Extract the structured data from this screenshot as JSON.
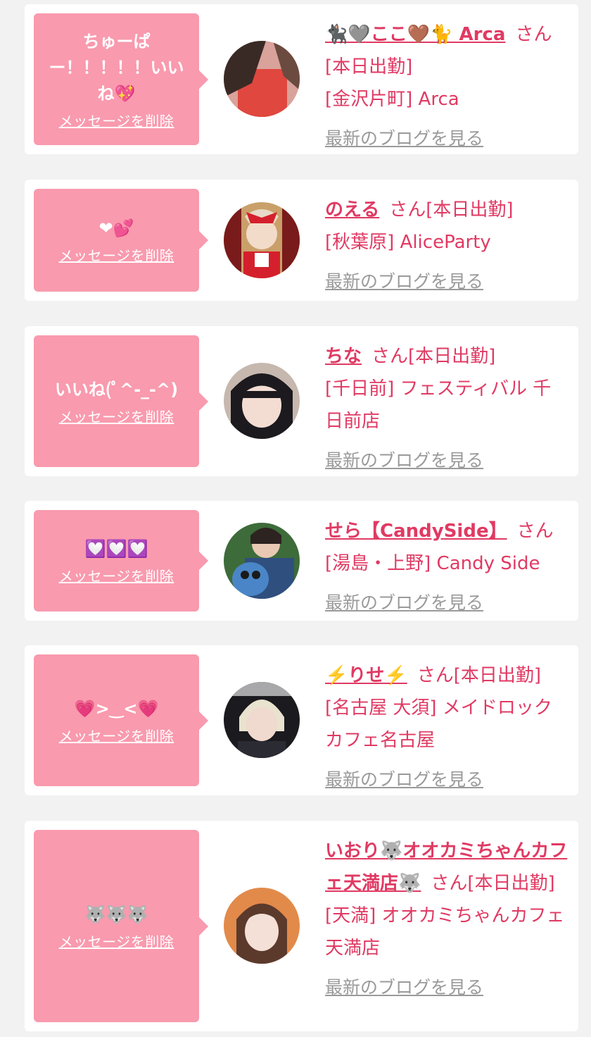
{
  "common": {
    "delete_label": "メッセージを削除",
    "blog_label": "最新のブログを見る",
    "san_label": "さん"
  },
  "items": [
    {
      "message": "ちゅーぱー！！！！！いいね💖",
      "name": "🐈‍⬛🩶ここ🤎🐈 Arca",
      "status": "[本日出勤]",
      "shop": "[金沢片町] Arca"
    },
    {
      "message": "❤︎💕",
      "name": "のえる",
      "status": "[本日出勤]",
      "shop": "[秋葉原] AliceParty"
    },
    {
      "message": "いいね(ﾟ^-_-^)",
      "name": "ちな",
      "status": "[本日出勤]",
      "shop": "[千日前] フェスティバル 千日前店"
    },
    {
      "message": "💟💟💟",
      "name": "せら【CandySide】",
      "status": "",
      "shop": "[湯島・上野] Candy Side"
    },
    {
      "message": "💗>‿<💗",
      "name": "⚡️りせ⚡️",
      "status": "[本日出勤]",
      "shop": "[名古屋 大須] メイドロックカフェ名古屋"
    },
    {
      "message": "🐺🐺🐺",
      "name": "いおり🐺オオカミちゃんカフェ天満店🐺",
      "status": "[本日出勤]",
      "shop": "[天満] オオカミちゃんカフェ天満店"
    }
  ]
}
